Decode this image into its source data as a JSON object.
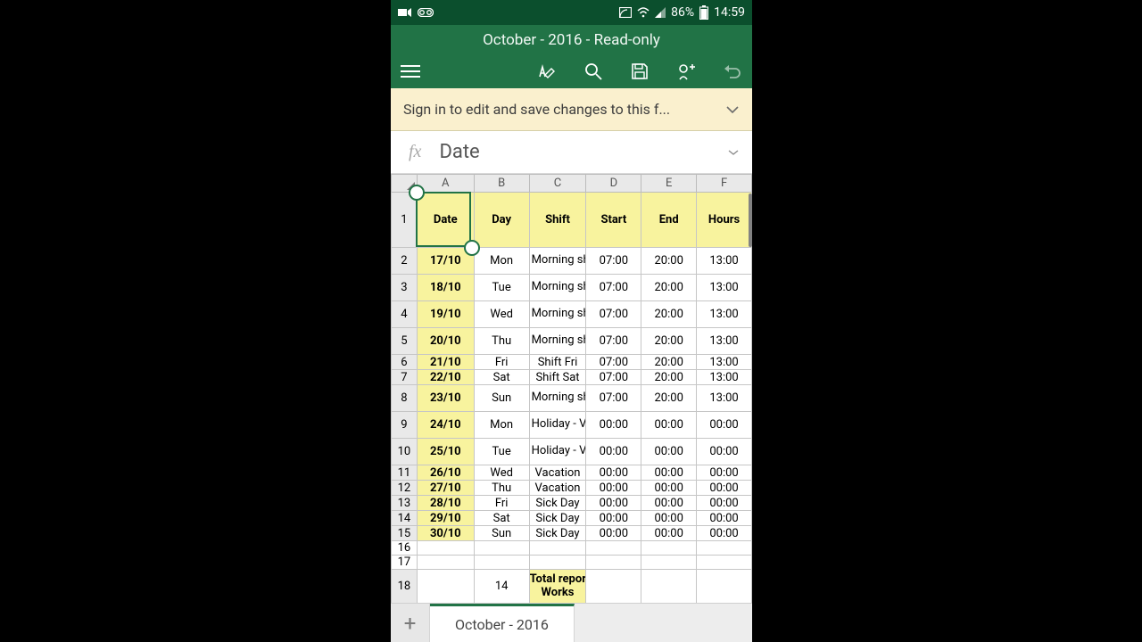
{
  "status": {
    "battery_pct": "86%",
    "time": "14:59"
  },
  "title": "October - 2016 - Read-only",
  "banner": {
    "message": "Sign in to edit and save changes to this f..."
  },
  "formula": {
    "fx": "fx",
    "value": "Date"
  },
  "columns": [
    "A",
    "B",
    "C",
    "D",
    "E",
    "F"
  ],
  "headers": {
    "A": "Date",
    "B": "Day",
    "C": "Shift",
    "D": "Start",
    "E": "End",
    "F": "Hours"
  },
  "rows": [
    {
      "n": "2",
      "date": "17/10",
      "day": "Mon",
      "shift": "Morning shift",
      "start": "07:00",
      "end": "20:00",
      "hours": "13:00",
      "multi": true
    },
    {
      "n": "3",
      "date": "18/10",
      "day": "Tue",
      "shift": "Morning shift",
      "start": "07:00",
      "end": "20:00",
      "hours": "13:00",
      "multi": true
    },
    {
      "n": "4",
      "date": "19/10",
      "day": "Wed",
      "shift": "Morning shift",
      "start": "07:00",
      "end": "20:00",
      "hours": "13:00",
      "multi": true
    },
    {
      "n": "5",
      "date": "20/10",
      "day": "Thu",
      "shift": "Morning shift",
      "start": "07:00",
      "end": "20:00",
      "hours": "13:00",
      "multi": true
    },
    {
      "n": "6",
      "date": "21/10",
      "day": "Fri",
      "shift": "Shift Fri",
      "start": "07:00",
      "end": "20:00",
      "hours": "13:00",
      "multi": false
    },
    {
      "n": "7",
      "date": "22/10",
      "day": "Sat",
      "shift": "Shift Sat",
      "start": "07:00",
      "end": "20:00",
      "hours": "13:00",
      "multi": false
    },
    {
      "n": "8",
      "date": "23/10",
      "day": "Sun",
      "shift": "Morning shift",
      "start": "07:00",
      "end": "20:00",
      "hours": "13:00",
      "multi": true
    },
    {
      "n": "9",
      "date": "24/10",
      "day": "Mon",
      "shift": "Holiday - Vacation",
      "start": "00:00",
      "end": "00:00",
      "hours": "00:00",
      "multi": true
    },
    {
      "n": "10",
      "date": "25/10",
      "day": "Tue",
      "shift": "Holiday - Vacation",
      "start": "00:00",
      "end": "00:00",
      "hours": "00:00",
      "multi": true
    },
    {
      "n": "11",
      "date": "26/10",
      "day": "Wed",
      "shift": "Vacation",
      "start": "00:00",
      "end": "00:00",
      "hours": "00:00",
      "multi": false
    },
    {
      "n": "12",
      "date": "27/10",
      "day": "Thu",
      "shift": "Vacation",
      "start": "00:00",
      "end": "00:00",
      "hours": "00:00",
      "multi": false
    },
    {
      "n": "13",
      "date": "28/10",
      "day": "Fri",
      "shift": "Sick Day",
      "start": "00:00",
      "end": "00:00",
      "hours": "00:00",
      "multi": false
    },
    {
      "n": "14",
      "date": "29/10",
      "day": "Sat",
      "shift": "Sick Day",
      "start": "00:00",
      "end": "00:00",
      "hours": "00:00",
      "multi": false
    },
    {
      "n": "15",
      "date": "30/10",
      "day": "Sun",
      "shift": "Sick Day",
      "start": "00:00",
      "end": "00:00",
      "hours": "00:00",
      "multi": false
    }
  ],
  "empty_rows": [
    "16",
    "17"
  ],
  "summary": {
    "row": "18",
    "count": "14",
    "label": "Total reports:",
    "partial": "Works"
  },
  "tab": {
    "add": "+",
    "active": "October - 2016"
  }
}
